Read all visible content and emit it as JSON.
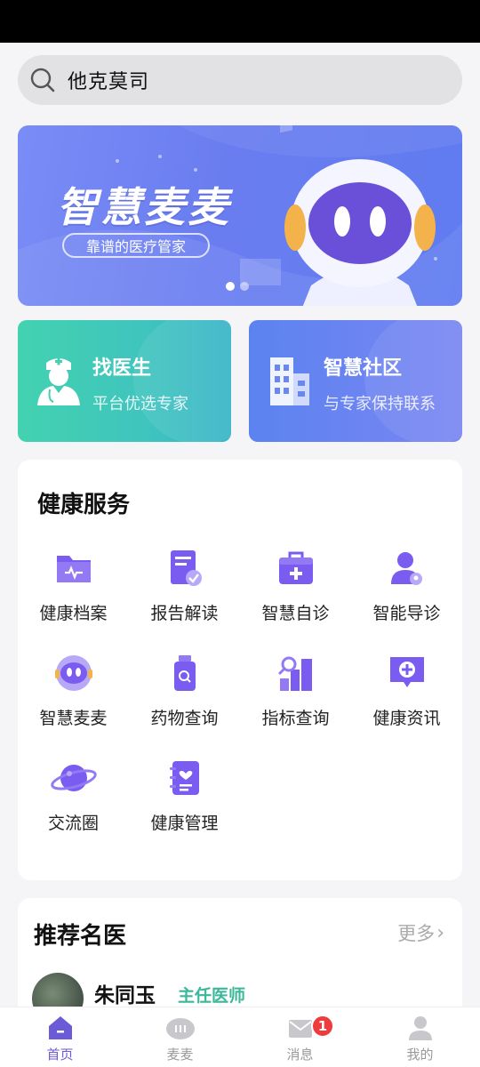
{
  "search": {
    "value": "他克莫司",
    "icon": "search-icon"
  },
  "banner": {
    "title": "智慧麦麦",
    "tagline": "靠谱的医疗管家",
    "slides": 2,
    "active_slide": 1
  },
  "cards": [
    {
      "title": "找医生",
      "subtitle": "平台优选专家",
      "icon": "doctor-icon"
    },
    {
      "title": "智慧社区",
      "subtitle": "与专家保持联系",
      "icon": "building-icon"
    }
  ],
  "health_services": {
    "title": "健康服务",
    "items": [
      {
        "label": "健康档案",
        "icon": "folder-heart-icon"
      },
      {
        "label": "报告解读",
        "icon": "report-check-icon"
      },
      {
        "label": "智慧自诊",
        "icon": "medical-kit-icon"
      },
      {
        "label": "智能导诊",
        "icon": "person-guide-icon"
      },
      {
        "label": "智慧麦麦",
        "icon": "robot-icon"
      },
      {
        "label": "药物查询",
        "icon": "medicine-bottle-icon"
      },
      {
        "label": "指标查询",
        "icon": "chart-search-icon"
      },
      {
        "label": "健康资讯",
        "icon": "health-news-icon"
      },
      {
        "label": "交流圈",
        "icon": "planet-icon"
      },
      {
        "label": "健康管理",
        "icon": "notebook-heart-icon"
      }
    ]
  },
  "recommended": {
    "title": "推荐名医",
    "more": "更多",
    "doctors": [
      {
        "name": "朱同玉",
        "title": "主任医师"
      }
    ]
  },
  "tabbar": {
    "tabs": [
      {
        "label": "首页",
        "icon": "home-icon",
        "active": true
      },
      {
        "label": "麦麦",
        "icon": "maimai-icon",
        "active": false
      },
      {
        "label": "消息",
        "icon": "message-icon",
        "active": false,
        "badge": "1"
      },
      {
        "label": "我的",
        "icon": "profile-icon",
        "active": false
      }
    ]
  },
  "colors": {
    "accent": "#6b5bd6",
    "icon_purple": "#7a5cf0",
    "doctor_green": "#3bb79a",
    "badge_red": "#ee3b3b"
  }
}
